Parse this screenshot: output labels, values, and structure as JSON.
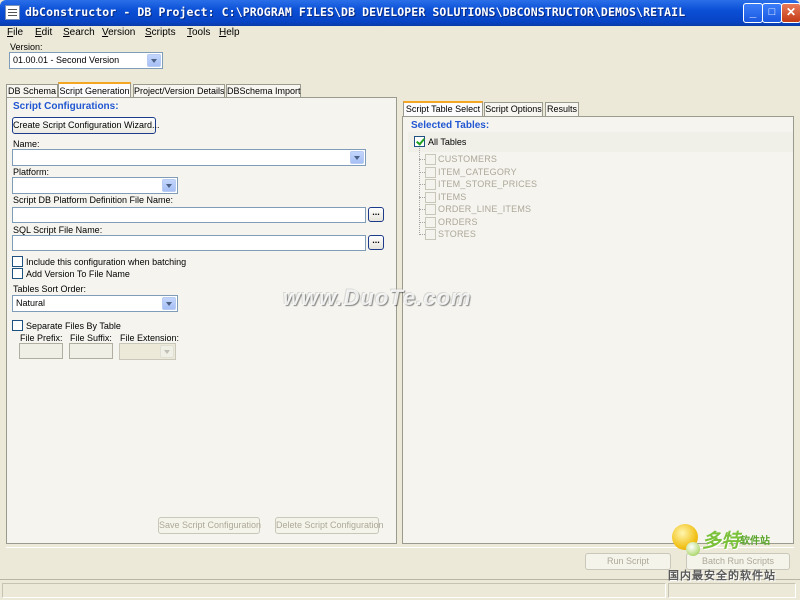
{
  "window": {
    "title": "dbConstructor - DB Project: C:\\PROGRAM FILES\\DB DEVELOPER SOLUTIONS\\DBCONSTRUCTOR\\DEMOS\\RETAIL",
    "minimize": "_",
    "maximize": "□",
    "close": "✕"
  },
  "menu": {
    "items": [
      {
        "u": "F",
        "rest": "ile"
      },
      {
        "u": "E",
        "rest": "dit"
      },
      {
        "u": "S",
        "rest": "earch"
      },
      {
        "u": "V",
        "rest": "ersion"
      },
      {
        "u": "S",
        "rest": "cripts"
      },
      {
        "u": "T",
        "rest": "ools"
      },
      {
        "u": "H",
        "rest": "elp"
      }
    ]
  },
  "version": {
    "label": "Version:",
    "selected": "01.00.01 - Second Version"
  },
  "main_tabs": [
    "DB Schema",
    "Script Generation",
    "Project/Version Details",
    "DBSchema Import"
  ],
  "left": {
    "section_title": "Script Configurations:",
    "wizard_button": "Create Script Configuration Wizard...",
    "name_label": "Name:",
    "name_value": "",
    "platform_label": "Platform:",
    "platform_value": "",
    "platform_def_label": "Script DB Platform Definition File Name:",
    "sql_file_label": "SQL Script File Name:",
    "ellipsis": "...",
    "include_batching": "Include this configuration when batching",
    "add_version": "Add Version To File Name",
    "sort_label": "Tables Sort Order:",
    "sort_value": "Natural",
    "separate_files": "Separate Files By Table",
    "file_prefix": "File Prefix:",
    "file_suffix": "File Suffix:",
    "file_extension": "File Extension:",
    "save_button": "Save Script Configuration",
    "delete_button": "Delete Script Configuration"
  },
  "right": {
    "tabs": [
      "Script Table Select",
      "Script Options",
      "Results"
    ],
    "selected_tables_title": "Selected Tables:",
    "all_tables": "All Tables",
    "all_tables_checked": true,
    "tables": [
      "CUSTOMERS",
      "ITEM_CATEGORY",
      "ITEM_STORE_PRICES",
      "ITEMS",
      "ORDER_LINE_ITEMS",
      "ORDERS",
      "STORES"
    ]
  },
  "bottom": {
    "run_script": "Run Script",
    "batch_scripts": "Batch Run Scripts"
  },
  "watermark": {
    "text": "www.DuoTe.com",
    "logo_cn": "多特",
    "logo_sub": "软件站",
    "logo_slogan": "国内最安全的软件站"
  }
}
